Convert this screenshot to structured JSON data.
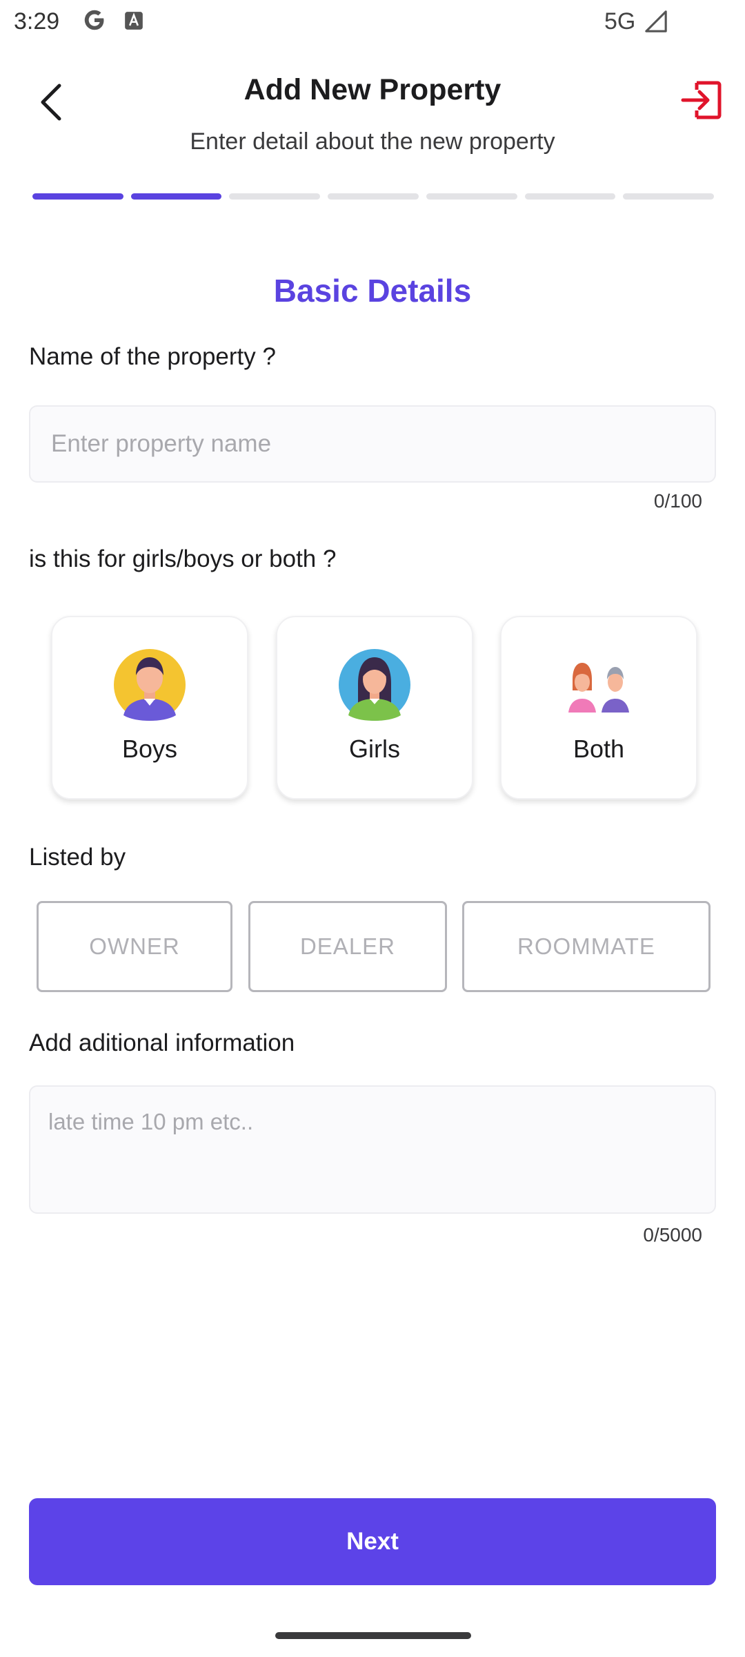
{
  "status_bar": {
    "time": "3:29",
    "network": "5G",
    "icons": [
      "google-g-icon",
      "text-a-icon",
      "signal-icon"
    ]
  },
  "header": {
    "title": "Add New Property",
    "subtitle": "Enter detail about the new property",
    "back_icon": "chevron-left-icon",
    "exit_icon": "exit-icon",
    "accent_color": "#e0142b"
  },
  "progress": {
    "total_steps": 7,
    "completed_steps": 2,
    "active_color": "#5a43e0"
  },
  "section_title": "Basic Details",
  "property_name": {
    "label": "Name of the property ?",
    "placeholder": "Enter property name",
    "value": "",
    "counter": "0/100"
  },
  "gender": {
    "label": "is this for girls/boys or both ?",
    "options": [
      {
        "label": "Boys",
        "icon": "boy-avatar-icon"
      },
      {
        "label": "Girls",
        "icon": "girl-avatar-icon"
      },
      {
        "label": "Both",
        "icon": "couple-avatar-icon"
      }
    ]
  },
  "listed_by": {
    "label": "Listed by",
    "options": [
      "OWNER",
      "DEALER",
      "ROOMMATE"
    ]
  },
  "additional_info": {
    "label": "Add aditional information",
    "placeholder": "late time 10 pm etc..",
    "value": "",
    "counter": "0/5000"
  },
  "next_button": {
    "label": "Next",
    "color": "#5c43e8"
  }
}
